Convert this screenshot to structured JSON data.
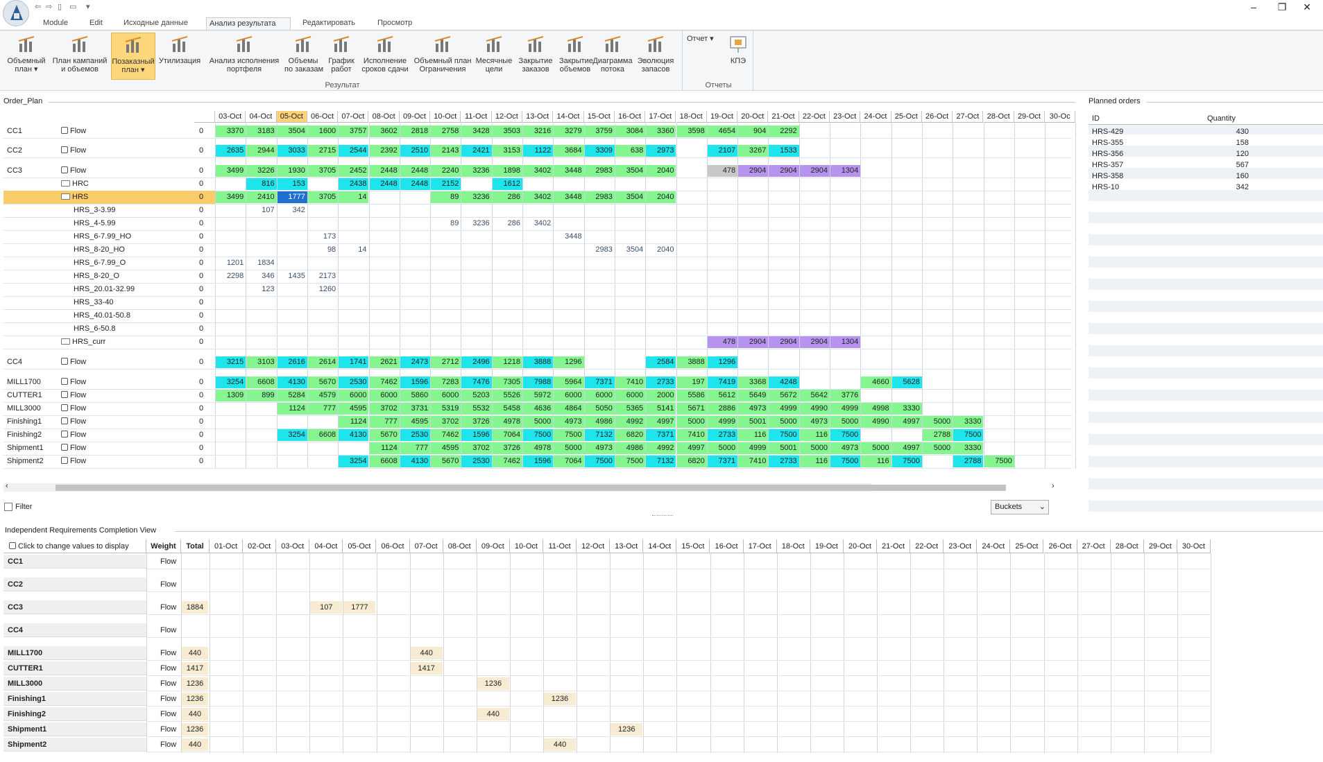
{
  "window": {
    "qa_icons": [
      "back-icon",
      "forward-icon",
      "copy-icon",
      "paste-icon",
      "dropdown-icon"
    ],
    "min": "–",
    "max": "❐",
    "close": "✕"
  },
  "tabs": [
    {
      "label": "Module"
    },
    {
      "label": "Edit"
    },
    {
      "label": "Исходные данные"
    },
    {
      "label": "Анализ результата",
      "active": true
    },
    {
      "label": "Редактировать"
    },
    {
      "label": "Просмотр"
    }
  ],
  "ribbon": {
    "groups": [
      {
        "name": "Результат"
      },
      {
        "name": "Отчеты"
      }
    ],
    "buttons": [
      {
        "l1": "Объемный",
        "l2": "план ▾",
        "icon": "volume-plan-icon"
      },
      {
        "l1": "План кампаний",
        "l2": "и объемов",
        "icon": "campaign-plan-icon"
      },
      {
        "l1": "Позаказный",
        "l2": "план ▾",
        "icon": "order-plan-icon",
        "selected": true
      },
      {
        "l1": "Утилизация",
        "l2": "",
        "icon": "utilization-icon"
      },
      {
        "l1": "Анализ исполнения",
        "l2": "портфеля",
        "icon": "portfolio-analysis-icon"
      },
      {
        "l1": "Объемы",
        "l2": "по заказам",
        "icon": "order-volumes-icon"
      },
      {
        "l1": "График",
        "l2": "работ",
        "icon": "work-schedule-icon"
      },
      {
        "l1": "Исполнение",
        "l2": "сроков сдачи",
        "icon": "deadline-icon"
      },
      {
        "l1": "Объемный план",
        "l2": "Ограничения",
        "icon": "constraints-icon"
      },
      {
        "l1": "Месячные",
        "l2": "цели",
        "icon": "monthly-goals-icon"
      },
      {
        "l1": "Закрытие",
        "l2": "заказов",
        "icon": "order-close-icon"
      },
      {
        "l1": "Закрытие",
        "l2": "объемов",
        "icon": "volume-close-icon"
      },
      {
        "l1": "Диаграмма",
        "l2": "потока",
        "icon": "flow-diagram-icon"
      },
      {
        "l1": "Эволюция",
        "l2": "запасов",
        "icon": "stock-evolution-icon"
      }
    ],
    "report_dropdown": "Отчет ▾",
    "kpe_label": "КПЭ"
  },
  "order_plan": {
    "title": "Order_Plan",
    "dates": [
      "03-Oct",
      "04-Oct",
      "05-Oct",
      "06-Oct",
      "07-Oct",
      "08-Oct",
      "09-Oct",
      "10-Oct",
      "11-Oct",
      "12-Oct",
      "13-Oct",
      "14-Oct",
      "15-Oct",
      "16-Oct",
      "17-Oct",
      "18-Oct",
      "19-Oct",
      "20-Oct",
      "21-Oct",
      "22-Oct",
      "23-Oct",
      "24-Oct",
      "25-Oct",
      "26-Oct",
      "27-Oct",
      "28-Oct",
      "29-Oct",
      "30-Oc"
    ],
    "highlight_date": "05-Oct",
    "rows": [
      {
        "group": "CC1",
        "label": "Flow",
        "icon": "flow",
        "zero": "0",
        "v": [
          "3370",
          "3183",
          "3504",
          "1600",
          "3757",
          "3602",
          "2818",
          "2758",
          "3428",
          "3503",
          "3216",
          "3279",
          "3759",
          "3084",
          "3360",
          "3598",
          "4654",
          "904",
          "2292",
          "",
          "",
          "",
          "",
          "",
          "",
          "",
          "",
          ""
        ],
        "c": "g"
      },
      {
        "group": "CC2",
        "label": "Flow",
        "icon": "flow",
        "zero": "0",
        "v": [
          "2635",
          "2944",
          "3033",
          "2715",
          "2544",
          "2392",
          "2510",
          "2143",
          "2421",
          "3153",
          "1122",
          "3684",
          "3309",
          "638",
          "2973",
          "",
          "2107",
          "3267",
          "1533",
          "",
          "",
          "",
          "",
          "",
          "",
          "",
          "",
          ""
        ],
        "c": "mix"
      },
      {
        "group": "CC3",
        "label": "Flow",
        "icon": "flow",
        "zero": "0",
        "v": [
          "3499",
          "3226",
          "1930",
          "3705",
          "2452",
          "2448",
          "2448",
          "2240",
          "3236",
          "1898",
          "3402",
          "3448",
          "2983",
          "3504",
          "2040",
          "",
          "478",
          "2904",
          "2904",
          "2904",
          "1304",
          "",
          "",
          "",
          "",
          "",
          "",
          ""
        ],
        "c": "g"
      },
      {
        "group": "",
        "label": "HRC",
        "icon": "folder",
        "zero": "0",
        "v": [
          "",
          "816",
          "153",
          "",
          "2438",
          "2448",
          "2448",
          "2152",
          "",
          "1612",
          "",
          "",
          "",
          "",
          "",
          "",
          "",
          "",
          "",
          "",
          "",
          "",
          "",
          "",
          "",
          "",
          "",
          ""
        ],
        "c": "c"
      },
      {
        "group": "",
        "label": "HRS",
        "icon": "folder",
        "zero": "0",
        "v": [
          "3499",
          "2410",
          "1777",
          "3705",
          "14",
          "",
          "",
          "89",
          "3236",
          "286",
          "3402",
          "3448",
          "2983",
          "3504",
          "2040",
          "",
          "",
          "",
          "",
          "",
          "",
          "",
          "",
          "",
          "",
          "",
          "",
          ""
        ],
        "c": "g",
        "selected": true
      },
      {
        "group": "",
        "label": "HRS_3-3.99",
        "icon": "none",
        "zero": "0",
        "v": [
          "",
          "107",
          "342",
          "",
          "",
          "",
          "",
          "",
          "",
          "",
          "",
          "",
          "",
          "",
          "",
          "",
          "",
          "",
          "",
          "",
          "",
          "",
          "",
          "",
          "",
          "",
          "",
          ""
        ],
        "c": "t"
      },
      {
        "group": "",
        "label": "HRS_4-5.99",
        "icon": "none",
        "zero": "0",
        "v": [
          "",
          "",
          "",
          "",
          "",
          "",
          "",
          "89",
          "3236",
          "286",
          "3402",
          "",
          "",
          "",
          "",
          "",
          "",
          "",
          "",
          "",
          "",
          "",
          "",
          "",
          "",
          "",
          "",
          ""
        ],
        "c": "t"
      },
      {
        "group": "",
        "label": "HRS_6-7.99_HO",
        "icon": "none",
        "zero": "0",
        "v": [
          "",
          "",
          "",
          "173",
          "",
          "",
          "",
          "",
          "",
          "",
          "",
          "3448",
          "",
          "",
          "",
          "",
          "",
          "",
          "",
          "",
          "",
          "",
          "",
          "",
          "",
          "",
          "",
          ""
        ],
        "c": "t"
      },
      {
        "group": "",
        "label": "HRS_8-20_HO",
        "icon": "none",
        "zero": "0",
        "v": [
          "",
          "",
          "",
          "98",
          "14",
          "",
          "",
          "",
          "",
          "",
          "",
          "",
          "2983",
          "3504",
          "2040",
          "",
          "",
          "",
          "",
          "",
          "",
          "",
          "",
          "",
          "",
          "",
          "",
          ""
        ],
        "c": "t"
      },
      {
        "group": "",
        "label": "HRS_6-7.99_O",
        "icon": "none",
        "zero": "0",
        "v": [
          "1201",
          "1834",
          "",
          "",
          "",
          "",
          "",
          "",
          "",
          "",
          "",
          "",
          "",
          "",
          "",
          "",
          "",
          "",
          "",
          "",
          "",
          "",
          "",
          "",
          "",
          "",
          "",
          ""
        ],
        "c": "t"
      },
      {
        "group": "",
        "label": "HRS_8-20_O",
        "icon": "none",
        "zero": "0",
        "v": [
          "2298",
          "346",
          "1435",
          "2173",
          "",
          "",
          "",
          "",
          "",
          "",
          "",
          "",
          "",
          "",
          "",
          "",
          "",
          "",
          "",
          "",
          "",
          "",
          "",
          "",
          "",
          "",
          "",
          ""
        ],
        "c": "t"
      },
      {
        "group": "",
        "label": "HRS_20.01-32.99",
        "icon": "none",
        "zero": "0",
        "v": [
          "",
          "123",
          "",
          "1260",
          "",
          "",
          "",
          "",
          "",
          "",
          "",
          "",
          "",
          "",
          "",
          "",
          "",
          "",
          "",
          "",
          "",
          "",
          "",
          "",
          "",
          "",
          "",
          ""
        ],
        "c": "t"
      },
      {
        "group": "",
        "label": "HRS_33-40",
        "icon": "none",
        "zero": "0",
        "v": [
          "",
          "",
          "",
          "",
          "",
          "",
          "",
          "",
          "",
          "",
          "",
          "",
          "",
          "",
          "",
          "",
          "",
          "",
          "",
          "",
          "",
          "",
          "",
          "",
          "",
          "",
          "",
          ""
        ],
        "c": "t"
      },
      {
        "group": "",
        "label": "HRS_40.01-50.8",
        "icon": "none",
        "zero": "0",
        "v": [
          "",
          "",
          "",
          "",
          "",
          "",
          "",
          "",
          "",
          "",
          "",
          "",
          "",
          "",
          "",
          "",
          "",
          "",
          "",
          "",
          "",
          "",
          "",
          "",
          "",
          "",
          "",
          ""
        ],
        "c": "t"
      },
      {
        "group": "",
        "label": "HRS_6-50.8",
        "icon": "none",
        "zero": "0",
        "v": [
          "",
          "",
          "",
          "",
          "",
          "",
          "",
          "",
          "",
          "",
          "",
          "",
          "",
          "",
          "",
          "",
          "",
          "",
          "",
          "",
          "",
          "",
          "",
          "",
          "",
          "",
          "",
          ""
        ],
        "c": "t"
      },
      {
        "group": "",
        "label": "HRS_curr",
        "icon": "folder",
        "zero": "0",
        "v": [
          "",
          "",
          "",
          "",
          "",
          "",
          "",
          "",
          "",
          "",
          "",
          "",
          "",
          "",
          "",
          "",
          "478",
          "2904",
          "2904",
          "2904",
          "1304",
          "",
          "",
          "",
          "",
          "",
          "",
          ""
        ],
        "c": "p"
      },
      {
        "group": "CC4",
        "label": "Flow",
        "icon": "flow",
        "zero": "0",
        "v": [
          "3215",
          "3103",
          "2616",
          "2614",
          "1741",
          "2621",
          "2473",
          "2712",
          "2496",
          "1218",
          "3888",
          "1296",
          "",
          "",
          "2584",
          "3888",
          "1296",
          "",
          "",
          "",
          "",
          "",
          "",
          "",
          "",
          "",
          "",
          ""
        ],
        "c": "mix"
      },
      {
        "group": "MILL1700",
        "label": "Flow",
        "icon": "flow",
        "zero": "0",
        "v": [
          "3254",
          "6608",
          "4130",
          "5670",
          "2530",
          "7462",
          "1596",
          "7283",
          "7476",
          "7305",
          "7988",
          "5964",
          "7371",
          "7410",
          "2733",
          "197",
          "7419",
          "3368",
          "4248",
          "",
          "",
          "4660",
          "5628",
          "",
          "",
          "",
          "",
          ""
        ],
        "c": "mix"
      },
      {
        "group": "CUTTER1",
        "label": "Flow",
        "icon": "flow",
        "zero": "0",
        "v": [
          "1309",
          "899",
          "5284",
          "4579",
          "6000",
          "6000",
          "5860",
          "6000",
          "5203",
          "5526",
          "5972",
          "6000",
          "6000",
          "6000",
          "2000",
          "5586",
          "5612",
          "5649",
          "5672",
          "5642",
          "3776",
          "",
          "",
          "",
          "",
          "",
          "",
          ""
        ],
        "c": "g"
      },
      {
        "group": "MILL3000",
        "label": "Flow",
        "icon": "flow",
        "zero": "0",
        "v": [
          "",
          "",
          "1124",
          "777",
          "4595",
          "3702",
          "3731",
          "5319",
          "5532",
          "5458",
          "4636",
          "4864",
          "5050",
          "5365",
          "5141",
          "5671",
          "2886",
          "4973",
          "4999",
          "4990",
          "4999",
          "4998",
          "3330",
          "",
          "",
          "",
          "",
          ""
        ],
        "c": "g"
      },
      {
        "group": "Finishing1",
        "label": "Flow",
        "icon": "flow",
        "zero": "0",
        "v": [
          "",
          "",
          "",
          "",
          "1124",
          "777",
          "4595",
          "3702",
          "3726",
          "4978",
          "5000",
          "4973",
          "4986",
          "4992",
          "4997",
          "5000",
          "4999",
          "5001",
          "5000",
          "4973",
          "5000",
          "4990",
          "4997",
          "5000",
          "3330",
          "",
          "",
          ""
        ],
        "c": "g"
      },
      {
        "group": "Finishing2",
        "label": "Flow",
        "icon": "flow",
        "zero": "0",
        "v": [
          "",
          "",
          "3254",
          "6608",
          "4130",
          "5670",
          "2530",
          "7462",
          "1596",
          "7064",
          "7500",
          "7500",
          "7132",
          "6820",
          "7371",
          "7410",
          "2733",
          "116",
          "7500",
          "116",
          "7500",
          "",
          "",
          "2788",
          "7500",
          "",
          "",
          ""
        ],
        "c": "mix"
      },
      {
        "group": "Shipment1",
        "label": "Flow",
        "icon": "flow",
        "zero": "0",
        "v": [
          "",
          "",
          "",
          "",
          "",
          "1124",
          "777",
          "4595",
          "3702",
          "3726",
          "4978",
          "5000",
          "4973",
          "4986",
          "4992",
          "4997",
          "5000",
          "4999",
          "5001",
          "5000",
          "4973",
          "5000",
          "4997",
          "5000",
          "3330",
          "",
          "",
          ""
        ],
        "c": "g"
      },
      {
        "group": "Shipment2",
        "label": "Flow",
        "icon": "flow",
        "zero": "0",
        "v": [
          "",
          "",
          "",
          "",
          "3254",
          "6608",
          "4130",
          "5670",
          "2530",
          "7462",
          "1596",
          "7064",
          "7500",
          "7500",
          "7132",
          "6820",
          "7371",
          "7410",
          "2733",
          "116",
          "7500",
          "116",
          "7500",
          "",
          "2788",
          "7500",
          "",
          ""
        ],
        "c": "mix"
      }
    ],
    "filter_label": "Filter",
    "buckets_label": "Buckets"
  },
  "planned_orders": {
    "title": "Planned orders",
    "col_id": "ID",
    "col_qty": "Quantity",
    "rows": [
      {
        "id": "HRS-429",
        "qty": "430"
      },
      {
        "id": "HRS-355",
        "qty": "158"
      },
      {
        "id": "HRS-356",
        "qty": "120"
      },
      {
        "id": "HRS-357",
        "qty": "567"
      },
      {
        "id": "HRS-358",
        "qty": "160"
      },
      {
        "id": "HRS-10",
        "qty": "342"
      }
    ]
  },
  "irc": {
    "title": "Independent Requirements Completion View",
    "click_label": "Click to change values to display",
    "weight": "Weight",
    "total": "Total",
    "dates": [
      "01-Oct",
      "02-Oct",
      "03-Oct",
      "04-Oct",
      "05-Oct",
      "06-Oct",
      "07-Oct",
      "08-Oct",
      "09-Oct",
      "10-Oct",
      "11-Oct",
      "12-Oct",
      "13-Oct",
      "14-Oct",
      "15-Oct",
      "16-Oct",
      "17-Oct",
      "18-Oct",
      "19-Oct",
      "20-Oct",
      "21-Oct",
      "22-Oct",
      "23-Oct",
      "24-Oct",
      "25-Oct",
      "26-Oct",
      "27-Oct",
      "28-Oct",
      "29-Oct",
      "30-Oct"
    ],
    "rows": [
      {
        "name": "CC1",
        "w": "Flow",
        "total": "",
        "vals": {}
      },
      {
        "name": "CC2",
        "w": "Flow",
        "total": "",
        "vals": {}
      },
      {
        "name": "CC3",
        "w": "Flow",
        "total": "1884",
        "vals": {
          "3": "107",
          "4": "1777"
        }
      },
      {
        "name": "CC4",
        "w": "Flow",
        "total": "",
        "vals": {}
      },
      {
        "name": "MILL1700",
        "w": "Flow",
        "total": "440",
        "vals": {
          "6": "440"
        }
      },
      {
        "name": "CUTTER1",
        "w": "Flow",
        "total": "1417",
        "vals": {
          "6": "1417"
        }
      },
      {
        "name": "MILL3000",
        "w": "Flow",
        "total": "1236",
        "vals": {
          "8": "1236"
        }
      },
      {
        "name": "Finishing1",
        "w": "Flow",
        "total": "1236",
        "vals": {
          "10": "1236"
        }
      },
      {
        "name": "Finishing2",
        "w": "Flow",
        "total": "440",
        "vals": {
          "8": "440"
        }
      },
      {
        "name": "Shipment1",
        "w": "Flow",
        "total": "1236",
        "vals": {
          "12": "1236"
        }
      },
      {
        "name": "Shipment2",
        "w": "Flow",
        "total": "440",
        "vals": {
          "10": "440"
        }
      }
    ]
  },
  "colors": {
    "green": "#84f58f",
    "cyan": "#1ee5ec",
    "purple": "#b694ee",
    "gray": "#c8c8c8",
    "selected": "#f9cc6a",
    "accent": "#1f6fd1"
  }
}
